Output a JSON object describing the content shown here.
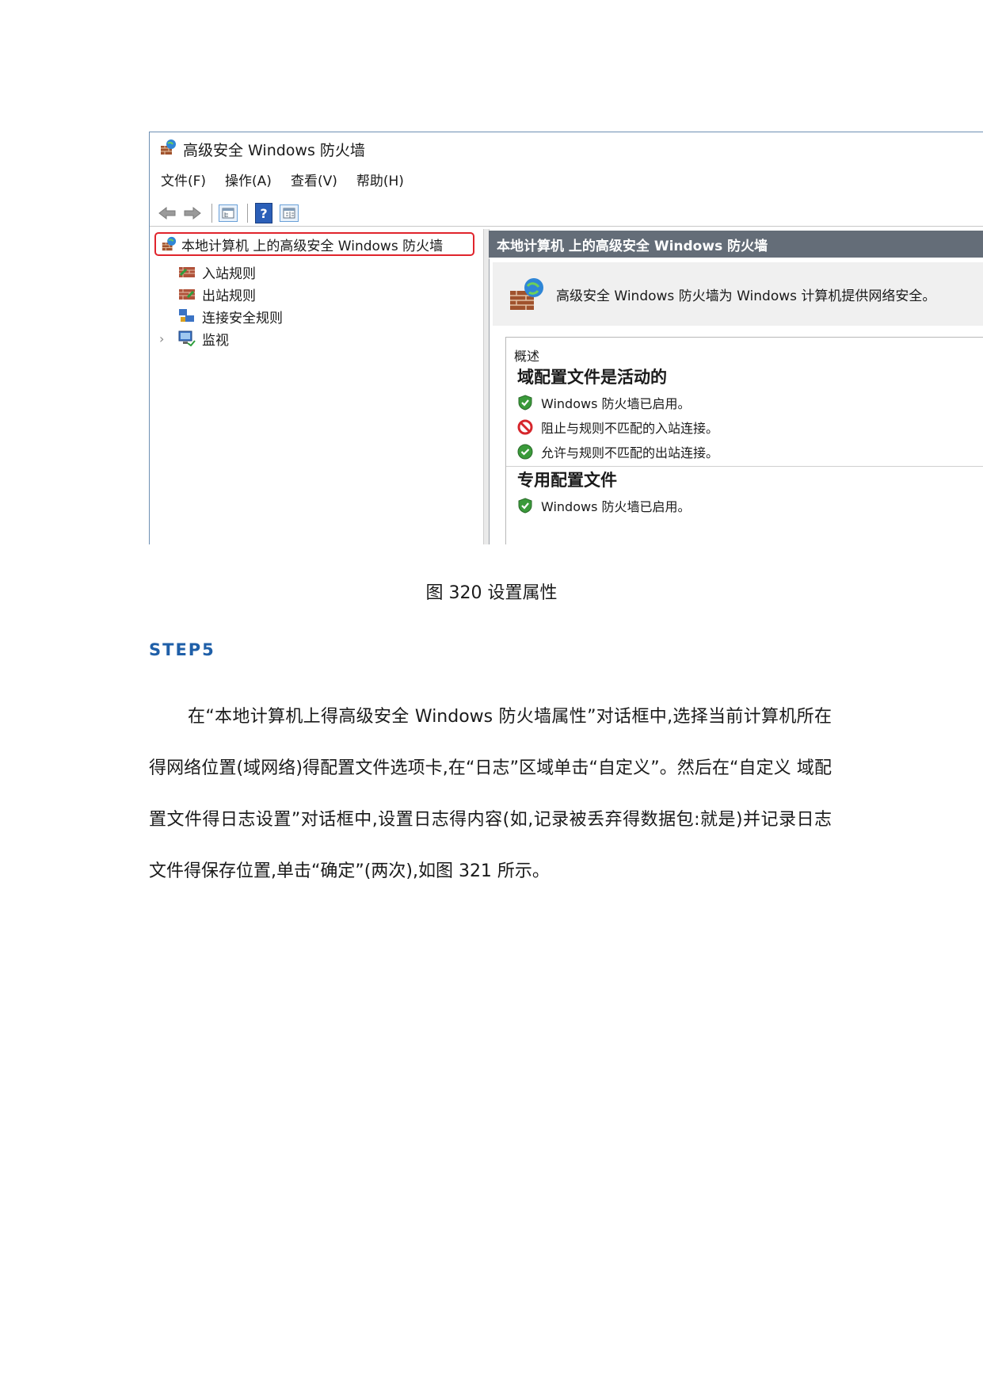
{
  "window": {
    "title": "高级安全 Windows 防火墙",
    "menu": [
      "文件(F)",
      "操作(A)",
      "查看(V)",
      "帮助(H)"
    ],
    "tree": {
      "root": "本地计算机 上的高级安全 Windows 防火墙",
      "items": [
        "入站规则",
        "出站规则",
        "连接安全规则",
        "监视"
      ]
    },
    "right_header": "本地计算机 上的高级安全 Windows 防火墙",
    "banner_text": "高级安全 Windows 防火墙为 Windows 计算机提供网络安全。",
    "overview": {
      "label": "概述",
      "domain_profile": {
        "heading": "域配置文件是活动的",
        "lines": [
          "Windows 防火墙已启用。",
          "阻止与规则不匹配的入站连接。",
          "允许与规则不匹配的出站连接。"
        ]
      },
      "private_profile": {
        "heading": "专用配置文件",
        "lines": [
          "Windows 防火墙已启用。"
        ]
      }
    }
  },
  "caption": "图 320  设置属性",
  "step": "STEP5",
  "paragraph": "在“本地计算机上得高级安全 Windows 防火墙属性”对话框中,选择当前计算机所在得网络位置(域网络)得配置文件选项卡,在“日志”区域单击“自定义”。然后在“自定义 域配置文件得日志设置”对话框中,设置日志得内容(如,记录被丢弃得数据包:就是)并记录日志文件得保存位置,单击“确定”(两次),如图 321 所示。",
  "colors": {
    "step": "#1f5fa8",
    "highlight": "#e0242c",
    "header_bg": "#646d78"
  }
}
